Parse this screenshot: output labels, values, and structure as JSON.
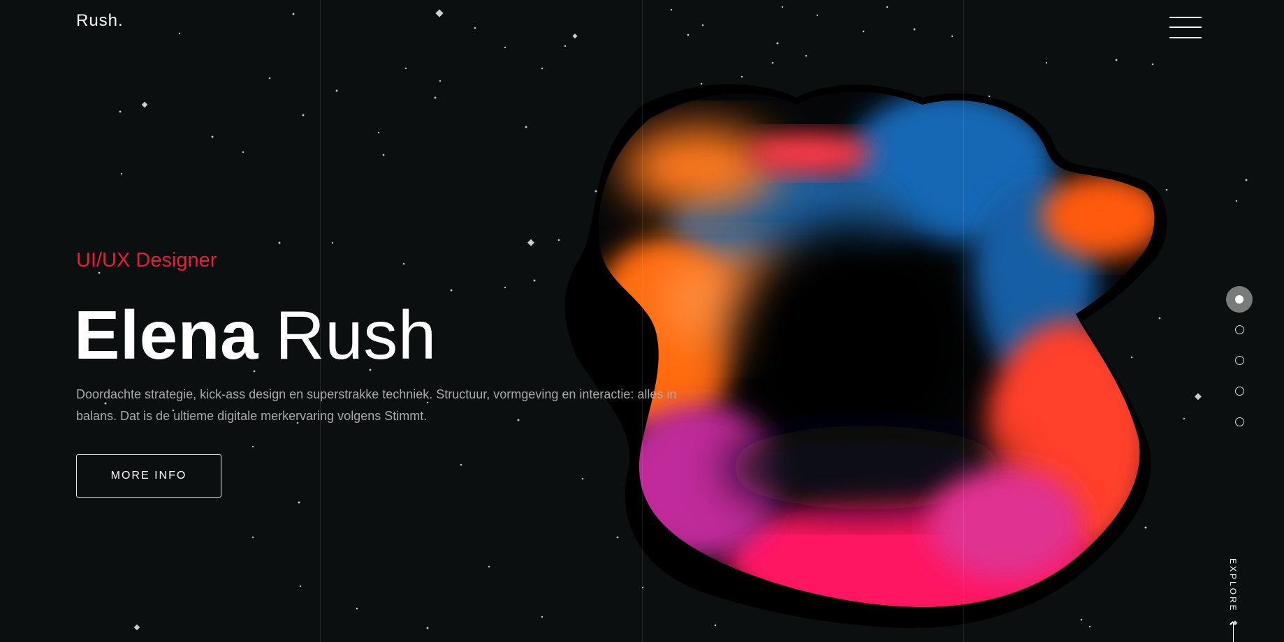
{
  "header": {
    "logo": "Rush.",
    "menu_icon": "hamburger-menu-icon"
  },
  "hero": {
    "subtitle": "UI/UX Designer",
    "first_name": "Elena",
    "last_name": "Rush",
    "description": "Doordachte strategie, kick-ass design en superstrakke techniek. Structuur, vormgeving en interactie: alles in balans. Dat is de ultieme digitale merkervaring volgens Stimmt.",
    "button_label": "MORE INFO"
  },
  "slider": {
    "total": 5,
    "active_index": 0
  },
  "explore_label": "EXPLORE",
  "colors": {
    "background": "#0c0f0f",
    "accent": "#ea1c3c",
    "text": "#ffffff",
    "muted_text": "#a9a9a9"
  }
}
